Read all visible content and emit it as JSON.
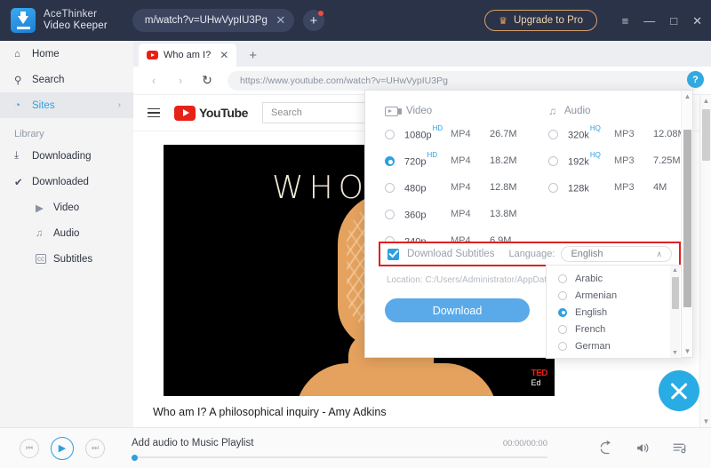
{
  "titlebar": {
    "brand_line1": "AceThinker",
    "brand_line2": "Video Keeper",
    "tab_url": "m/watch?v=UHwVypIU3Pg",
    "tab_close": "✕",
    "add_tab": "+",
    "upgrade_label": "Upgrade to Pro",
    "crown_icon": "♛",
    "menu_icon": "≡",
    "minimize_icon": "—",
    "maximize_icon": "□",
    "close_icon": "✕"
  },
  "sidebar": {
    "items": [
      {
        "label": "Home",
        "icon": "⌂"
      },
      {
        "label": "Search",
        "icon": "⚲"
      },
      {
        "label": "Sites",
        "icon": "◔",
        "chevron": "›"
      }
    ],
    "section_label": "Library",
    "library": [
      {
        "label": "Downloading",
        "icon": "⤓"
      },
      {
        "label": "Downloaded",
        "icon": "✔"
      }
    ],
    "sub_items": [
      {
        "label": "Video",
        "icon": "▶"
      },
      {
        "label": "Audio",
        "icon": "♫"
      },
      {
        "label": "Subtitles",
        "icon": "cc"
      }
    ]
  },
  "browser": {
    "tab_label": "Who am I?",
    "tab_close": "✕",
    "new_tab": "+",
    "back_icon": "‹",
    "forward_icon": "›",
    "reload_icon": "↻",
    "url": "https://www.youtube.com/watch?v=UHwVypIU3Pg",
    "help_icon": "?"
  },
  "youtube": {
    "logo_text": "YouTube",
    "search_placeholder": "Search",
    "thumb_text": "WHO",
    "ted_top": "TED",
    "ted_bottom": "Ed",
    "video_title": "Who am I? A philosophical inquiry - Amy Adkins",
    "close_overlay": "✕"
  },
  "popup": {
    "video_header": "Video",
    "audio_header": "Audio",
    "video_options": [
      {
        "quality": "1080p",
        "badge": "HD",
        "format": "MP4",
        "size": "26.7M",
        "selected": false
      },
      {
        "quality": "720p",
        "badge": "HD",
        "format": "MP4",
        "size": "18.2M",
        "selected": true
      },
      {
        "quality": "480p",
        "badge": "",
        "format": "MP4",
        "size": "12.8M",
        "selected": false
      },
      {
        "quality": "360p",
        "badge": "",
        "format": "MP4",
        "size": "13.8M",
        "selected": false
      },
      {
        "quality": "240p",
        "badge": "",
        "format": "MP4",
        "size": "6.9M",
        "selected": false
      }
    ],
    "audio_options": [
      {
        "quality": "320k",
        "badge": "HQ",
        "format": "MP3",
        "size": "12.08M",
        "selected": false
      },
      {
        "quality": "192k",
        "badge": "HQ",
        "format": "MP3",
        "size": "7.25M",
        "selected": false
      },
      {
        "quality": "128k",
        "badge": "",
        "format": "MP3",
        "size": "4M",
        "selected": false
      }
    ],
    "subtitles_label": "Download Subtitles",
    "subtitles_checked": true,
    "language_label": "Language:",
    "language_value": "English",
    "language_caret": "∧",
    "languages": [
      {
        "label": "Arabic",
        "selected": false
      },
      {
        "label": "Armenian",
        "selected": false
      },
      {
        "label": "English",
        "selected": true
      },
      {
        "label": "French",
        "selected": false
      },
      {
        "label": "German",
        "selected": false
      }
    ],
    "location": "Location: C:/Users/Administrator/AppDat",
    "download_label": "Download",
    "scroll_up": "▲",
    "scroll_down": "▼"
  },
  "player": {
    "prev_icon": "⏮",
    "play_icon": "▶",
    "next_icon": "⏭",
    "track_title": "Add audio to Music Playlist",
    "timecode": "00:00/00:00",
    "repeat_icon": "↻",
    "volume_icon": "ᴴ",
    "playlist_icon": "☰"
  },
  "colors": {
    "titlebar": "#2b3348",
    "accent_blue": "#2f9fe0",
    "highlight_red": "#e01f1f",
    "download_button": "#5aaaea",
    "youtube_red": "#e62117",
    "upgrade_border": "#d7a06a"
  }
}
